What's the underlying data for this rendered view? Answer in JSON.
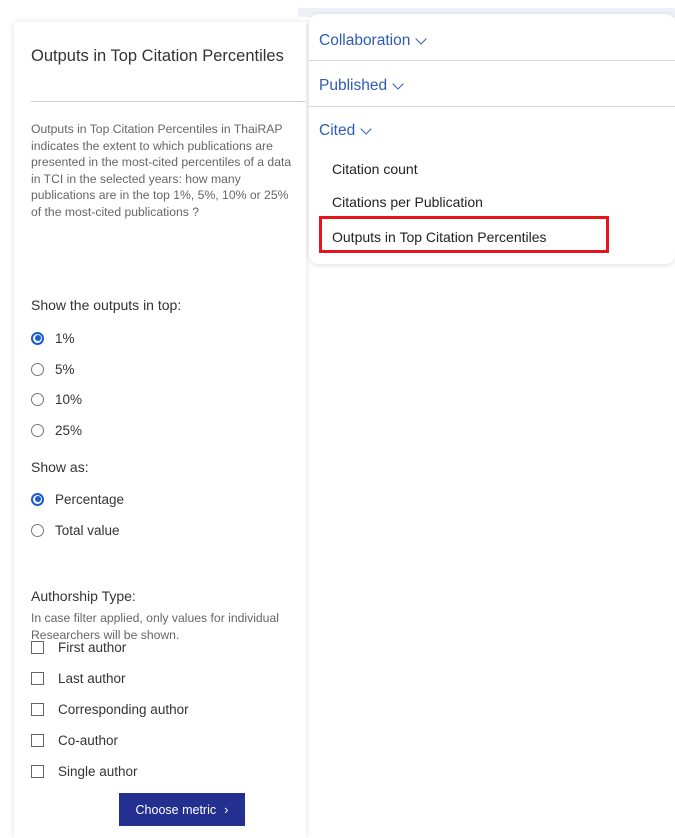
{
  "left_panel": {
    "title": "Outputs in Top Citation Percentiles",
    "description": "Outputs in Top Citation Percentiles in ThaiRAP indicates the extent to which publications are presented in the most-cited percentiles of a data in TCI in the selected years: how many publications are in the top 1%, 5%, 10% or 25% of the most-cited publications ?",
    "top_outputs": {
      "heading": "Show the outputs in top:",
      "options": [
        {
          "label": "1%",
          "checked": true
        },
        {
          "label": "5%",
          "checked": false
        },
        {
          "label": "10%",
          "checked": false
        },
        {
          "label": "25%",
          "checked": false
        }
      ]
    },
    "show_as": {
      "heading": "Show as:",
      "options": [
        {
          "label": "Percentage",
          "checked": true
        },
        {
          "label": "Total value",
          "checked": false
        }
      ]
    },
    "authorship": {
      "heading": "Authorship Type:",
      "note": "In case filter applied, only values for individual Researchers will be shown.",
      "options": [
        {
          "label": "First author",
          "checked": false
        },
        {
          "label": "Last author",
          "checked": false
        },
        {
          "label": "Corresponding author",
          "checked": false
        },
        {
          "label": "Co-author",
          "checked": false
        },
        {
          "label": "Single author",
          "checked": false
        }
      ]
    },
    "choose_button": {
      "label": "Choose metric",
      "icon": "chevron-right-icon"
    }
  },
  "right_menu": {
    "sections": [
      {
        "label": "Collaboration",
        "icon": "chevron-down-icon"
      },
      {
        "label": "Published",
        "icon": "chevron-down-icon"
      },
      {
        "label": "Cited",
        "icon": "chevron-down-icon"
      }
    ],
    "cited_items": [
      {
        "label": "Citation count"
      },
      {
        "label": "Citations per Publication"
      },
      {
        "label": "Outputs in Top Citation Percentiles",
        "highlighted": true
      }
    ]
  },
  "colors": {
    "accent": "#1a5bd1",
    "menu_link": "#2d5bb8",
    "button": "#23308f",
    "highlight": "#e8141b"
  }
}
